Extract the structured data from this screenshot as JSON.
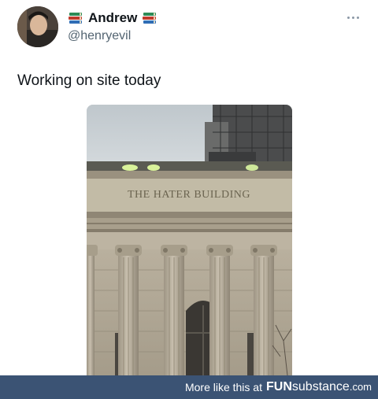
{
  "author": {
    "display_name": "Andrew",
    "handle": "@henryevil",
    "name_emoji": "books-icon"
  },
  "tweet": {
    "text": "Working on site today"
  },
  "photo": {
    "sign_text": "THE HATER BUILDING"
  },
  "footer": {
    "prompt": "More like this at",
    "brand_part1": "FUN",
    "brand_part2": "substance",
    "brand_part3": ".com"
  }
}
